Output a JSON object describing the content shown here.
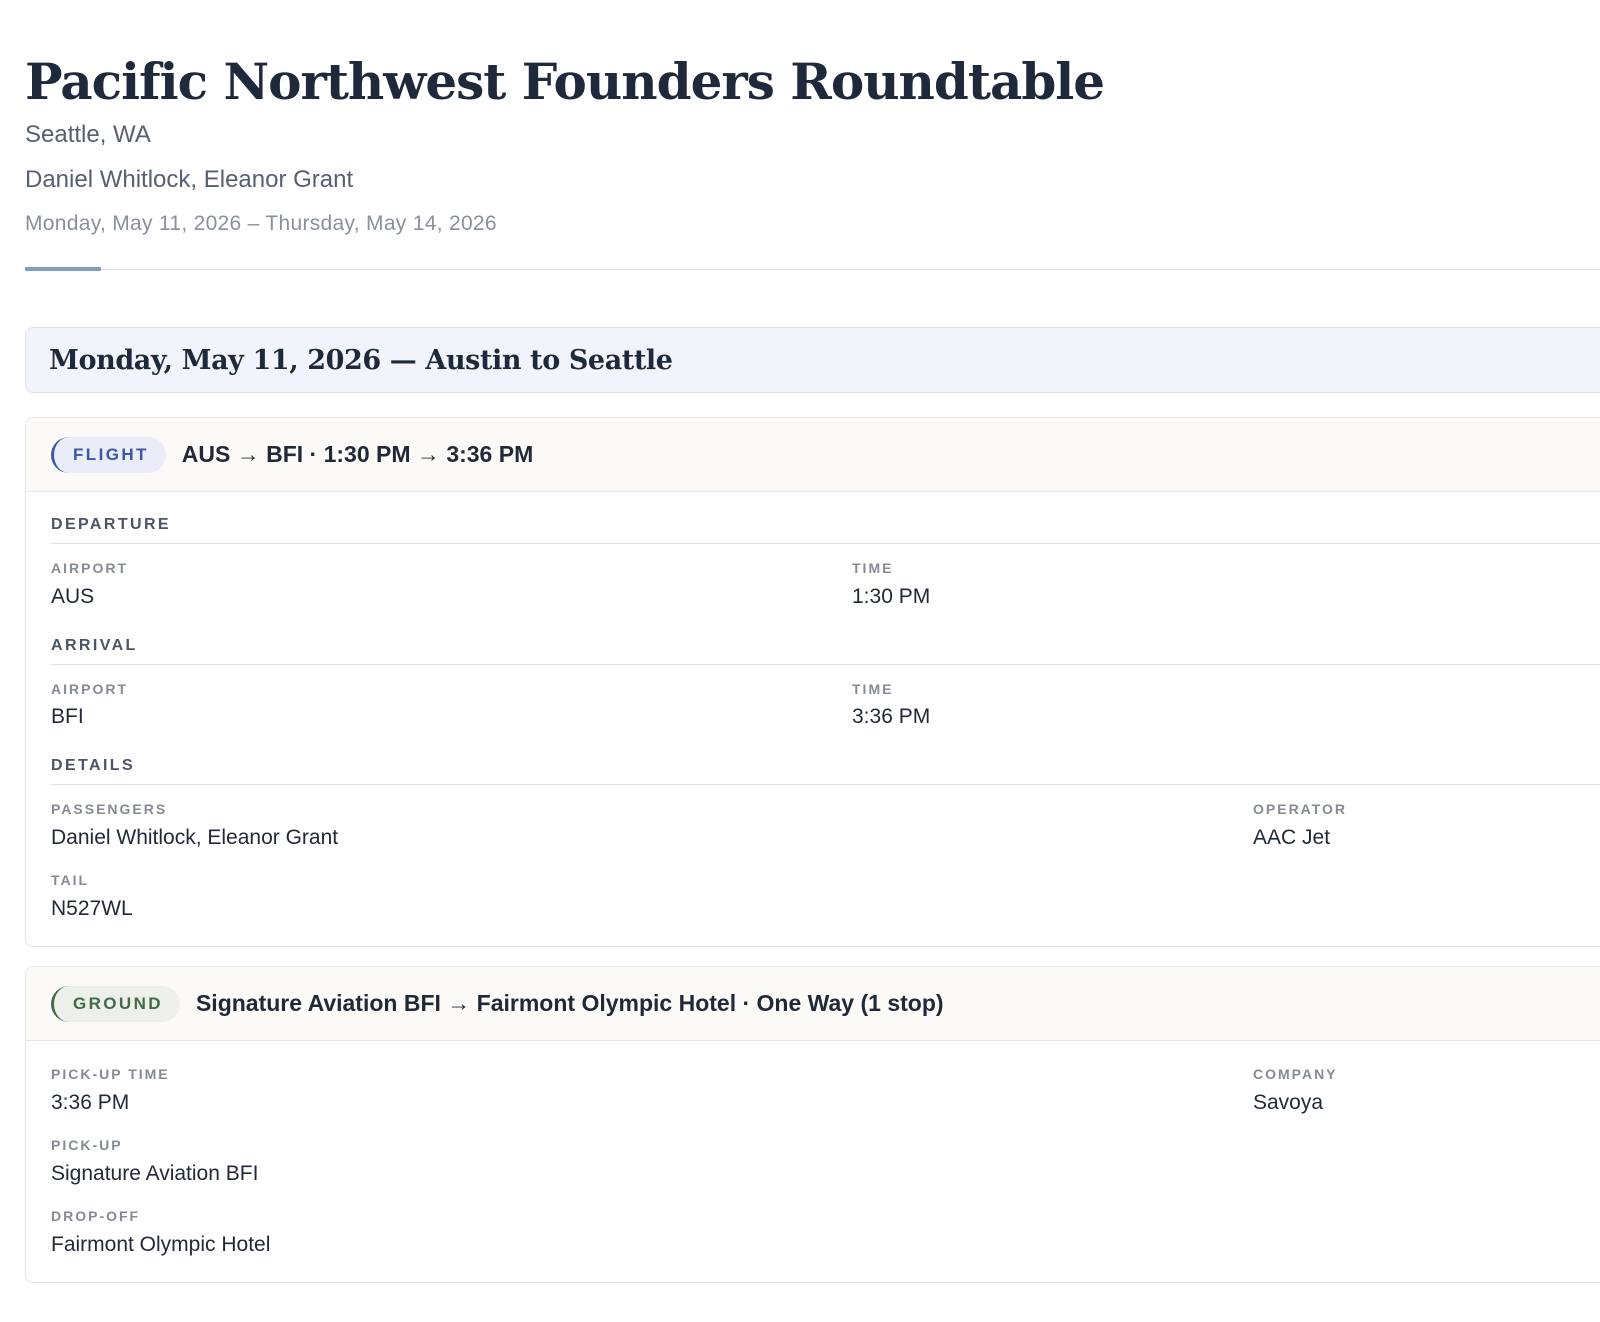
{
  "trip": {
    "title": "Pacific Northwest Founders Roundtable",
    "location": "Seattle, WA",
    "travelers": "Daniel Whitlock, Eleanor Grant",
    "dates": "Monday, May 11, 2026 – Thursday, May 14, 2026"
  },
  "day": {
    "header": "Monday, May 11, 2026 — Austin to Seattle"
  },
  "flight": {
    "badge": "FLIGHT",
    "summary": "AUS → BFI · 1:30 PM → 3:36 PM",
    "departure": {
      "section": "DEPARTURE",
      "airport_label": "AIRPORT",
      "airport": "AUS",
      "time_label": "TIME",
      "time": "1:30 PM"
    },
    "arrival": {
      "section": "ARRIVAL",
      "airport_label": "AIRPORT",
      "airport": "BFI",
      "time_label": "TIME",
      "time": "3:36 PM"
    },
    "details": {
      "section": "DETAILS",
      "passengers_label": "PASSENGERS",
      "passengers": "Daniel Whitlock, Eleanor Grant",
      "operator_label": "OPERATOR",
      "operator": "AAC Jet",
      "tail_label": "TAIL",
      "tail": "N527WL"
    }
  },
  "ground": {
    "badge": "GROUND",
    "summary": "Signature Aviation BFI → Fairmont Olympic Hotel · One Way (1 stop)",
    "pickup_time_label": "PICK-UP TIME",
    "pickup_time": "3:36 PM",
    "company_label": "COMPANY",
    "company": "Savoya",
    "pickup_label": "PICK-UP",
    "pickup": "Signature Aviation BFI",
    "dropoff_label": "DROP-OFF",
    "dropoff": "Fairmont Olympic Hotel"
  },
  "colors": {
    "flight_accent": "#3a56a8",
    "ground_accent": "#3f6b47",
    "day_header_bg": "#f1f5fb",
    "rule_accent": "#7f9fbf"
  }
}
